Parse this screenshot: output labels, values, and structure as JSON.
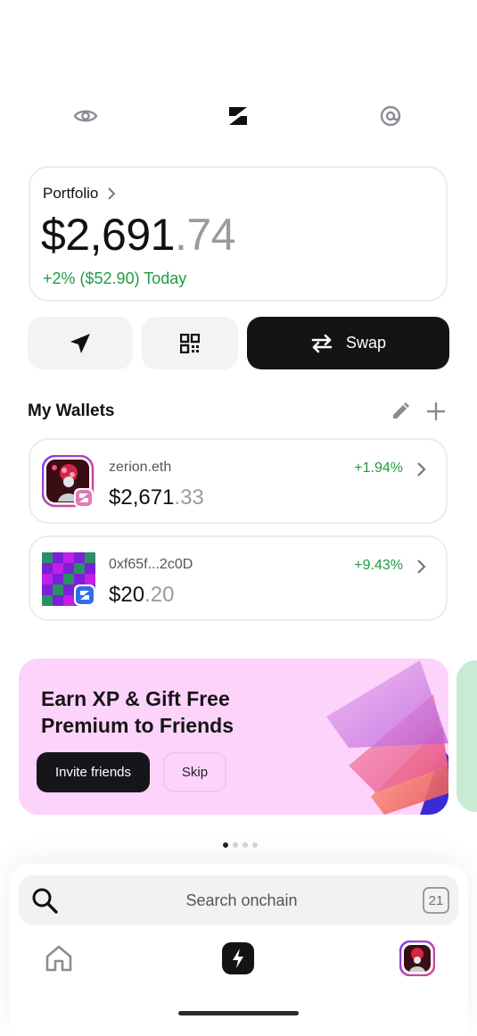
{
  "top_bar": {
    "icons": [
      "eye-icon",
      "zerion-logo-icon",
      "at-sign-icon"
    ]
  },
  "portfolio": {
    "label": "Portfolio",
    "value_main": "$2,691",
    "value_cents": ".74",
    "change": "+2% ($52.90) Today"
  },
  "actions": {
    "send_icon": "send-icon",
    "receive_icon": "qr-code-icon",
    "swap_label": "Swap",
    "swap_icon": "swap-arrows-icon"
  },
  "wallets": {
    "title": "My Wallets",
    "edit_icon": "pencil-icon",
    "add_icon": "plus-icon",
    "items": [
      {
        "name": "zerion.eth",
        "value_main": "$2,671",
        "value_cents": ".33",
        "change": "+1.94%"
      },
      {
        "name": "0xf65f...2c0D",
        "value_main": "$20",
        "value_cents": ".20",
        "change": "+9.43%"
      }
    ]
  },
  "promo": {
    "title_line1": "Earn XP & Gift Free",
    "title_line2": "Premium to Friends",
    "invite_label": "Invite friends",
    "skip_label": "Skip",
    "pages": 4,
    "active_page": 1
  },
  "search": {
    "placeholder": "Search onchain",
    "badge": "21"
  },
  "bottom_nav": {
    "icons": [
      "home-icon",
      "lightning-icon",
      "profile-avatar"
    ]
  },
  "colors": {
    "positive": "#1f9c43",
    "dark": "#141416",
    "promo_bg": "#fdd3fb"
  }
}
